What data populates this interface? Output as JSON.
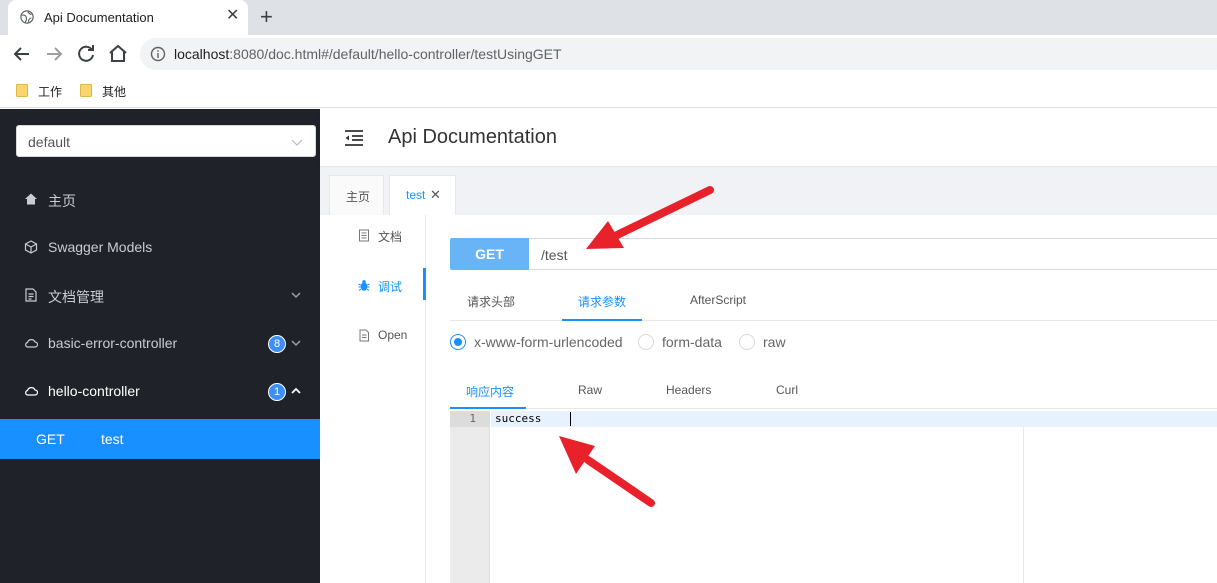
{
  "browser": {
    "tab_title": "Api Documentation",
    "url_host": "localhost",
    "url_rest": ":8080/doc.html#/default/hello-controller/testUsingGET",
    "bookmarks": [
      "工作",
      "其他"
    ]
  },
  "sidebar": {
    "group_select": "default",
    "items": [
      {
        "label": "主页",
        "icon": "home-icon"
      },
      {
        "label": "Swagger Models",
        "icon": "cube-icon"
      },
      {
        "label": "文档管理",
        "icon": "doc-manage-icon"
      },
      {
        "label": "basic-error-controller",
        "icon": "cloud-icon",
        "badge": "8"
      },
      {
        "label": "hello-controller",
        "icon": "cloud-icon",
        "badge": "1"
      }
    ],
    "sub_item": {
      "method": "GET",
      "path": "test"
    }
  },
  "header": {
    "title": "Api Documentation"
  },
  "page_tabs": [
    {
      "label": "主页"
    },
    {
      "label": "test"
    }
  ],
  "vertical_tabs": [
    {
      "label": "文档",
      "icon": "document-icon"
    },
    {
      "label": "调试",
      "icon": "bug-icon"
    },
    {
      "label": "Open",
      "icon": "file-icon"
    }
  ],
  "request": {
    "method": "GET",
    "path": "/test",
    "tabs": [
      "请求头部",
      "请求参数",
      "AfterScript"
    ],
    "body_types": [
      "x-www-form-urlencoded",
      "form-data",
      "raw"
    ]
  },
  "response": {
    "tabs": [
      "响应内容",
      "Raw",
      "Headers",
      "Curl"
    ],
    "line_number": "1",
    "code": "success"
  },
  "colors": {
    "accent": "#1890ff",
    "sidebar_bg": "#1f2329",
    "get_method": "#69b3f7",
    "annotation_arrow": "#e8212b"
  }
}
